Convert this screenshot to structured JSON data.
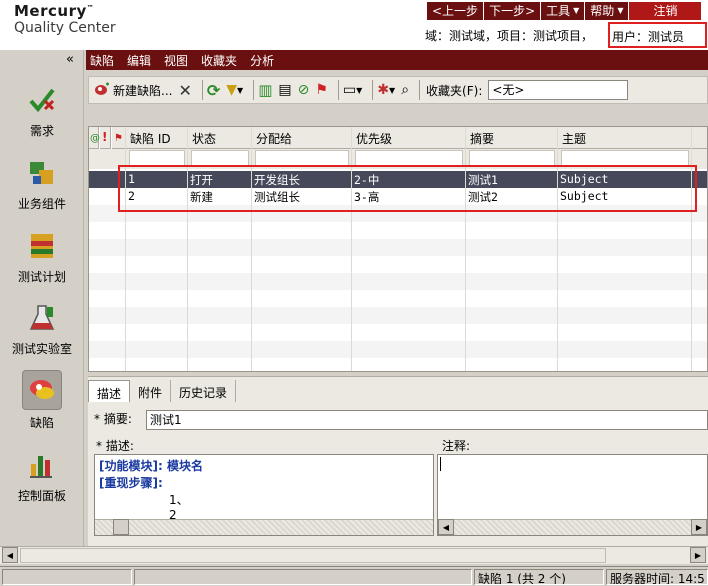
{
  "header": {
    "brand": "Mercury",
    "brand_tm": "™",
    "product": "Quality Center",
    "nav": {
      "prev": "<上一步",
      "next": "下一步>",
      "tools": "工具",
      "help": "帮助",
      "logout": "注销"
    },
    "context": "域：测试域，项目：测试项目，",
    "user": "用户：测试员"
  },
  "sidebar": {
    "collapse": "«",
    "items": [
      {
        "label": "需求",
        "icon": "requirements-icon"
      },
      {
        "label": "业务组件",
        "icon": "business-components-icon"
      },
      {
        "label": "测试计划",
        "icon": "test-plan-icon"
      },
      {
        "label": "测试实验室",
        "icon": "test-lab-icon"
      },
      {
        "label": "缺陷",
        "icon": "defects-icon"
      },
      {
        "label": "控制面板",
        "icon": "dashboard-icon"
      }
    ]
  },
  "menubar": [
    "缺陷",
    "编辑",
    "视图",
    "收藏夹",
    "分析"
  ],
  "toolbar": {
    "new_defect": "新建缺陷...",
    "favorites_label": "收藏夹(F):",
    "favorites_value": "<无>"
  },
  "grid": {
    "columns": [
      "",
      "!",
      "",
      "缺陷 ID",
      "状态",
      "分配给",
      "优先级",
      "摘要",
      "主题"
    ],
    "rows": [
      {
        "id": "1",
        "status": "打开",
        "assignee": "开发组长",
        "priority": "2-中",
        "summary": "测试1",
        "subject": "Subject"
      },
      {
        "id": "2",
        "status": "新建",
        "assignee": "测试组长",
        "priority": "3-高",
        "summary": "测试2",
        "subject": "Subject"
      }
    ]
  },
  "detail": {
    "tabs": [
      "描述",
      "附件",
      "历史记录"
    ],
    "summary_label": "* 摘要:",
    "summary_value": "测试1",
    "desc_label": "* 描述:",
    "note_label": "注释:",
    "desc_lines": [
      "[功能模块]: 模块名",
      "[重现步骤]:",
      "1、",
      "2"
    ]
  },
  "statusbar": {
    "count": "缺陷 1 (共 2 个)",
    "server_time": "服务器时间: 14:5"
  },
  "colors": {
    "menu": "#6b1010",
    "selection": "#45495a",
    "highlight": "#e02020"
  }
}
